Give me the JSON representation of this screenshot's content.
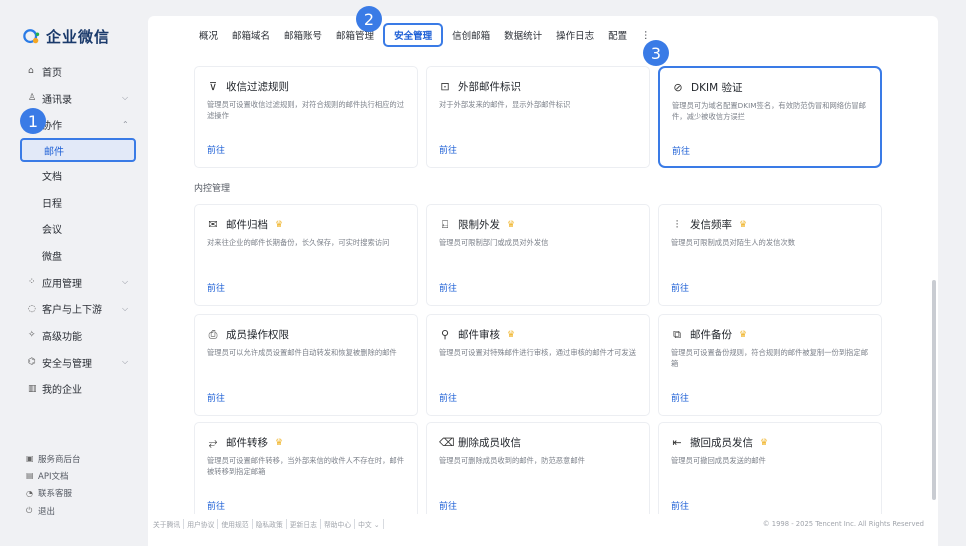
{
  "app": {
    "brand": "企业微信"
  },
  "sidebar": {
    "items": [
      {
        "icon": "home-icon",
        "glyph": "⌂",
        "label": "首页"
      },
      {
        "icon": "contacts-icon",
        "glyph": "♙",
        "label": "通讯录",
        "chevron": "⌵"
      },
      {
        "icon": "collab-icon",
        "glyph": "▦",
        "label": "协作",
        "chevron": "⌃"
      },
      {
        "label": "邮件",
        "sub": true,
        "active": true
      },
      {
        "label": "文档",
        "sub": true
      },
      {
        "label": "日程",
        "sub": true
      },
      {
        "label": "会议",
        "sub": true
      },
      {
        "label": "微盘",
        "sub": true
      },
      {
        "icon": "apps-icon",
        "glyph": "⁘",
        "label": "应用管理",
        "chevron": "⌵"
      },
      {
        "icon": "customer-icon",
        "glyph": "◌",
        "label": "客户与上下游",
        "chevron": "⌵"
      },
      {
        "icon": "advanced-icon",
        "glyph": "✧",
        "label": "高级功能"
      },
      {
        "icon": "security-icon",
        "glyph": "⌬",
        "label": "安全与管理",
        "chevron": "⌵"
      },
      {
        "icon": "company-icon",
        "glyph": "▥",
        "label": "我的企业"
      }
    ],
    "bottom": [
      {
        "icon": "service-icon",
        "glyph": "▣",
        "label": "服务商后台"
      },
      {
        "icon": "api-icon",
        "glyph": "▤",
        "label": "API文档"
      },
      {
        "icon": "support-icon",
        "glyph": "◔",
        "label": "联系客服"
      },
      {
        "icon": "logout-icon",
        "glyph": "⏻",
        "label": "退出"
      }
    ]
  },
  "tabs": [
    {
      "label": "概况"
    },
    {
      "label": "邮箱域名"
    },
    {
      "label": "邮箱账号"
    },
    {
      "label": "邮箱管理"
    },
    {
      "label": "安全管理",
      "active": true
    },
    {
      "label": "信创邮箱"
    },
    {
      "label": "数据统计"
    },
    {
      "label": "操作日志"
    },
    {
      "label": "配置"
    },
    {
      "label": "⋮"
    }
  ],
  "badges": [
    "1",
    "2",
    "3"
  ],
  "section_neikong": "内控管理",
  "link_label": "前往",
  "cards": [
    {
      "icon": "filter-icon",
      "glyph": "⊽",
      "title": "收信过滤规则",
      "vip": false,
      "desc": "管理员可设置收信过滤规则，对符合规则的邮件执行相应的过滤操作"
    },
    {
      "icon": "external-mail-icon",
      "glyph": "⊡",
      "title": "外部邮件标识",
      "vip": false,
      "desc": "对于外部发来的邮件，显示外部邮件标识"
    },
    {
      "icon": "dkim-icon",
      "glyph": "⊘",
      "title": "DKIM 验证",
      "vip": false,
      "highlight": true,
      "desc": "管理员可为域名配置DKIM签名，有效防范伪冒和网络仿冒邮件，减少被收信方误拦"
    },
    {
      "icon": "archive-icon",
      "glyph": "✉",
      "title": "邮件归档",
      "vip": true,
      "desc": "对来往企业的邮件长期备份，长久保存，可实时搜索访问"
    },
    {
      "icon": "restrict-icon",
      "glyph": "⍇",
      "title": "限制外发",
      "vip": true,
      "desc": "管理员可限制部门或成员对外发信"
    },
    {
      "icon": "frequency-icon",
      "glyph": "⫶",
      "title": "发信频率",
      "vip": true,
      "desc": "管理员可限制成员对陌生人的发信次数"
    },
    {
      "icon": "permission-icon",
      "glyph": "⎙",
      "title": "成员操作权限",
      "vip": false,
      "desc": "管理员可以允许成员设置邮件自动转发和恢复被删除的邮件"
    },
    {
      "icon": "audit-icon",
      "glyph": "⚲",
      "title": "邮件审核",
      "vip": true,
      "desc": "管理员可设置对特殊邮件进行审核，通过审核的邮件才可发送"
    },
    {
      "icon": "backup-icon",
      "glyph": "⧉",
      "title": "邮件备份",
      "vip": true,
      "desc": "管理员可设置备份规则，符合规则的邮件被复制一份到指定邮箱"
    },
    {
      "icon": "forward-icon",
      "glyph": "⥂",
      "title": "邮件转移",
      "vip": true,
      "desc": "管理员可设置邮件转移，当外部来信的收件人不存在时，邮件被转移到指定邮箱"
    },
    {
      "icon": "delete-mail-icon",
      "glyph": "⌫",
      "title": "删除成员收信",
      "vip": false,
      "desc": "管理员可删除成员收到的邮件，防范恶意邮件"
    },
    {
      "icon": "recall-icon",
      "glyph": "⇤",
      "title": "撤回成员发信",
      "vip": true,
      "desc": "管理员可撤回成员发送的邮件"
    }
  ],
  "footer": {
    "links": [
      "关于腾讯",
      "用户协议",
      "使用规范",
      "隐私政策",
      "更新日志",
      "帮助中心",
      "中文 ⌄"
    ],
    "copyright": "© 1998 - 2025 Tencent Inc. All Rights Reserved"
  },
  "colors": {
    "accent": "#1e60d6",
    "highlight": "#3a7be6",
    "vip": "#f0b429"
  }
}
